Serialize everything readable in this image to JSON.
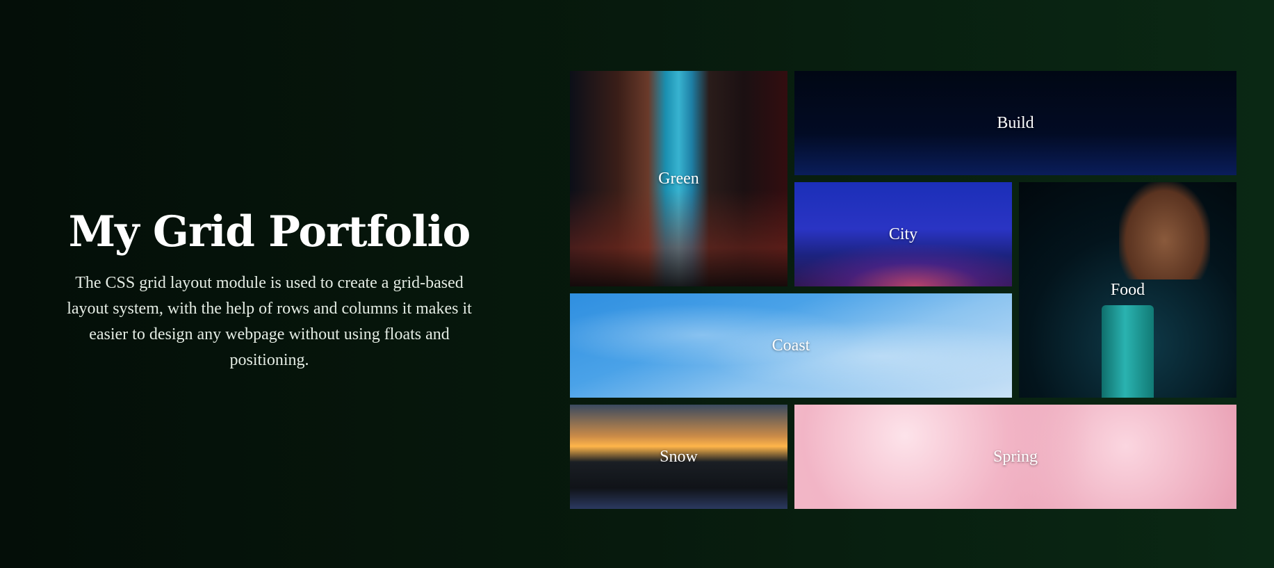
{
  "intro": {
    "title": "My Grid Portfolio",
    "description": "The CSS grid layout module is used to create a grid-based layout system, with the help of rows and columns it makes it easier to design any webpage without using floats and positioning."
  },
  "tiles": [
    {
      "label": "Green"
    },
    {
      "label": "Build"
    },
    {
      "label": "City"
    },
    {
      "label": "Food"
    },
    {
      "label": "Coast"
    },
    {
      "label": "Snow"
    },
    {
      "label": "Spring"
    }
  ]
}
